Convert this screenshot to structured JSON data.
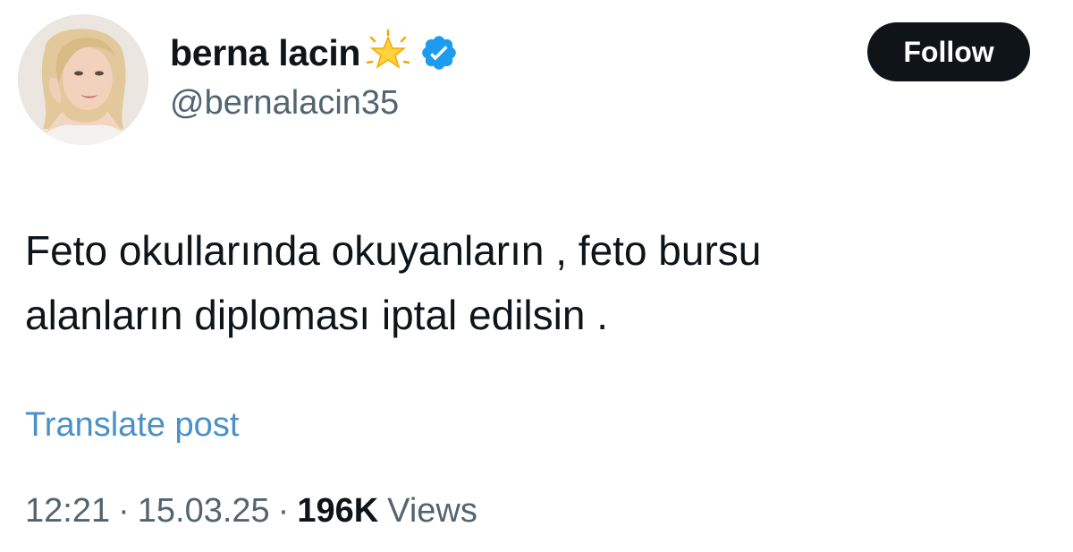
{
  "author": {
    "display_name": "berna lacin",
    "handle": "@bernalacin35",
    "emoji": "star-emoji",
    "verified": true,
    "avatar": "profile-photo"
  },
  "actions": {
    "follow_label": "Follow"
  },
  "post": {
    "lines": [
      "Feto okullarında okuyanların , feto bursu",
      "alanların diploması iptal edilsin ."
    ]
  },
  "translate_label": "Translate post",
  "meta": {
    "time": "12:21",
    "separator": "·",
    "date": "15.03.25",
    "views_count": "196K",
    "views_label": "Views"
  },
  "colors": {
    "text": "#0f1419",
    "secondary": "#536471",
    "link": "#4a90c8",
    "verified": "#1d9bf0",
    "follow_bg": "#0f1419"
  }
}
